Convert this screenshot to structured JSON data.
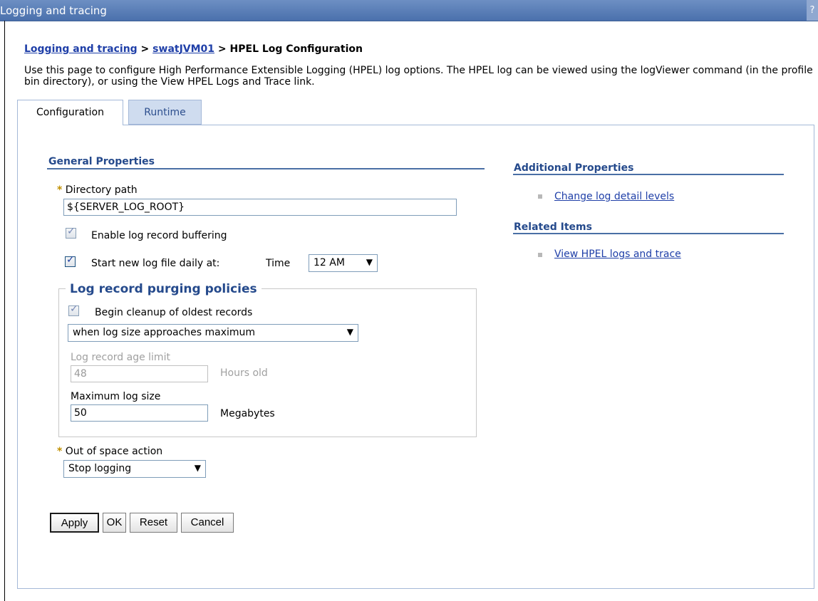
{
  "window": {
    "title": "Logging and tracing",
    "help_label": "?"
  },
  "breadcrumb": {
    "item1": "Logging and tracing",
    "sep1": " > ",
    "item2": "swatJVM01",
    "sep2": " > ",
    "current": "HPEL Log Configuration"
  },
  "description": "Use this page to configure High Performance Extensible Logging (HPEL) log options. The HPEL log can be viewed using the logViewer command (in the profile bin directory), or using the View HPEL Logs and Trace link.",
  "tabs": {
    "configuration": "Configuration",
    "runtime": "Runtime"
  },
  "general": {
    "title": "General Properties",
    "required_marker": "*",
    "directory_path_label": "Directory path",
    "directory_path_value": "${SERVER_LOG_ROOT}",
    "enable_buffering_label": "Enable log record buffering",
    "enable_buffering_checked": true,
    "start_new_label": "Start new log file daily at:",
    "time_label": "Time",
    "start_new_checked": true,
    "time_value": "12 AM",
    "purging": {
      "legend": "Log record purging policies",
      "begin_cleanup_label": "Begin cleanup of oldest records",
      "begin_cleanup_checked": true,
      "cleanup_mode": "when log size approaches maximum",
      "age_limit_label": "Log record age limit",
      "age_limit_value": "48",
      "age_unit": "Hours old",
      "max_size_label": "Maximum log size",
      "max_size_value": "50",
      "max_size_unit": "Megabytes"
    },
    "out_of_space_label": "Out of space action",
    "out_of_space_value": "Stop logging"
  },
  "buttons": {
    "apply": "Apply",
    "ok": "OK",
    "reset": "Reset",
    "cancel": "Cancel"
  },
  "additional": {
    "title": "Additional Properties",
    "link": "Change log detail levels"
  },
  "related": {
    "title": "Related Items",
    "link": "View HPEL logs and trace"
  },
  "colors": {
    "titlebar": "#4a70ac",
    "link": "#1f3fa8",
    "section_title": "#254a8c",
    "required": "#c09000"
  }
}
